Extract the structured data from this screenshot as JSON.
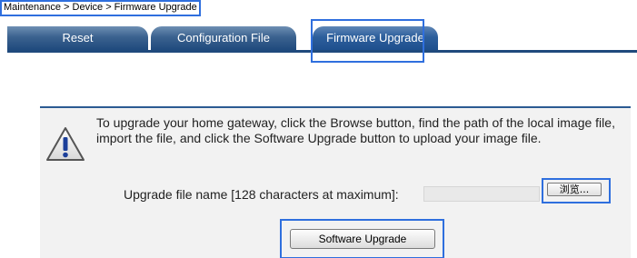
{
  "breadcrumb": {
    "text": "Maintenance > Device > Firmware Upgrade"
  },
  "tabs": [
    {
      "label": "Reset",
      "active": false
    },
    {
      "label": "Configuration File",
      "active": false
    },
    {
      "label": "Firmware Upgrade",
      "active": true
    }
  ],
  "panel": {
    "message": "To upgrade your home gateway, click the Browse button, find the path of the local image file, import the file, and click the Software Upgrade button to upload your image file.",
    "warning_icon": "warning-triangle-icon",
    "upgrade_label": "Upgrade file name [128 characters at maximum]:",
    "file_value": "",
    "browse_label": "浏览...",
    "software_upgrade_label": "Software Upgrade"
  },
  "colors": {
    "tab_dark": "#1f4a7d",
    "tab_light": "#6e8fb3",
    "highlight": "#2f6fde",
    "panel_bg": "#f2f2f2"
  }
}
